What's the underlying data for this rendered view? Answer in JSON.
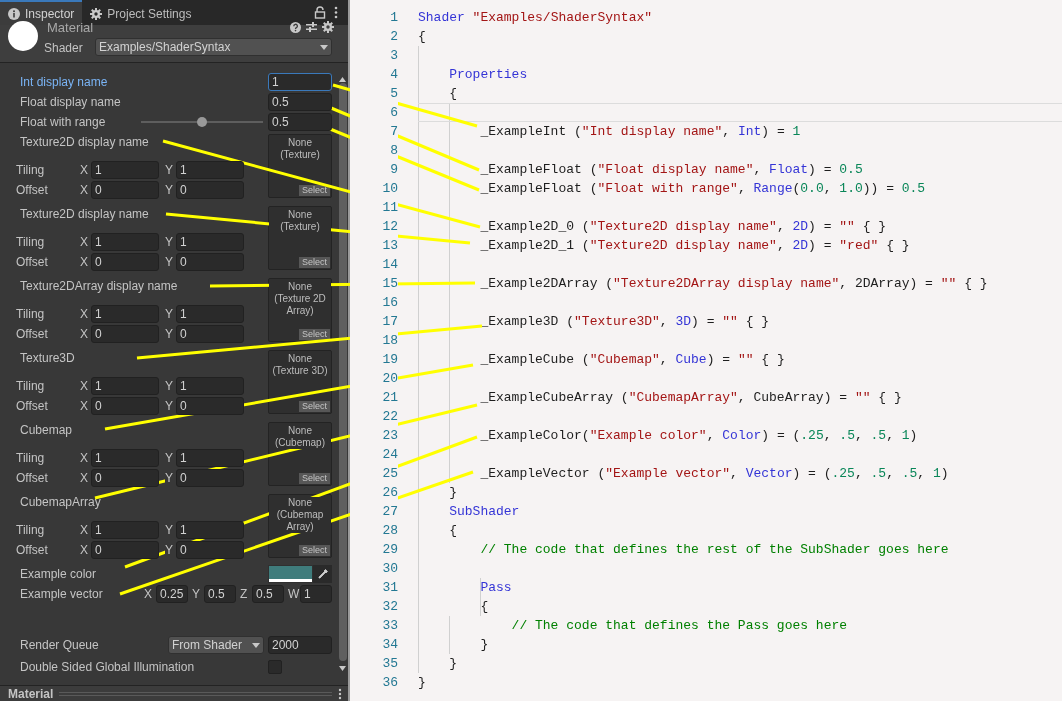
{
  "tabs": [
    {
      "label": "Inspector",
      "selected": true
    },
    {
      "label": "Project Settings",
      "selected": false
    }
  ],
  "header": {
    "title": "Material",
    "shader_label": "Shader",
    "shader_value": "Examples/ShaderSyntax"
  },
  "properties": [
    {
      "kind": "int",
      "label": "Int display name",
      "value": "1",
      "focused": true
    },
    {
      "kind": "float",
      "label": "Float display name",
      "value": "0.5",
      "focused": false
    },
    {
      "kind": "range",
      "label": "Float with range",
      "value": "0.5",
      "level": 0.5,
      "focused": false
    },
    {
      "kind": "texture",
      "label": "Texture2D display name",
      "focused": false,
      "thumbnail": "None (Texture)",
      "select": "Select",
      "tiling_label": "Tiling",
      "offset_label": "Offset",
      "tiling": [
        {
          "axis": "X",
          "value": "1"
        },
        {
          "axis": "Y",
          "value": "1"
        }
      ],
      "offset": [
        {
          "axis": "X",
          "value": "0"
        },
        {
          "axis": "Y",
          "value": "0"
        }
      ]
    },
    {
      "kind": "texture",
      "label": "Texture2D display name",
      "focused": false,
      "thumbnail": "None (Texture)",
      "select": "Select",
      "tiling_label": "Tiling",
      "offset_label": "Offset",
      "tiling": [
        {
          "axis": "X",
          "value": "1"
        },
        {
          "axis": "Y",
          "value": "1"
        }
      ],
      "offset": [
        {
          "axis": "X",
          "value": "0"
        },
        {
          "axis": "Y",
          "value": "0"
        }
      ]
    },
    {
      "kind": "texture",
      "label": "Texture2DArray display name",
      "focused": false,
      "thumbnail": "None (Texture 2D Array)",
      "select": "Select",
      "tiling_label": "Tiling",
      "offset_label": "Offset",
      "tiling": [
        {
          "axis": "X",
          "value": "1"
        },
        {
          "axis": "Y",
          "value": "1"
        }
      ],
      "offset": [
        {
          "axis": "X",
          "value": "0"
        },
        {
          "axis": "Y",
          "value": "0"
        }
      ]
    },
    {
      "kind": "texture",
      "label": "Texture3D",
      "focused": false,
      "thumbnail": "None (Texture 3D)",
      "select": "Select",
      "tiling_label": "Tiling",
      "offset_label": "Offset",
      "tiling": [
        {
          "axis": "X",
          "value": "1"
        },
        {
          "axis": "Y",
          "value": "1"
        }
      ],
      "offset": [
        {
          "axis": "X",
          "value": "0"
        },
        {
          "axis": "Y",
          "value": "0"
        }
      ]
    },
    {
      "kind": "texture",
      "label": "Cubemap",
      "focused": false,
      "thumbnail": "None (Cubemap)",
      "select": "Select",
      "tiling_label": "Tiling",
      "offset_label": "Offset",
      "tiling": [
        {
          "axis": "X",
          "value": "1"
        },
        {
          "axis": "Y",
          "value": "1"
        }
      ],
      "offset": [
        {
          "axis": "X",
          "value": "0"
        },
        {
          "axis": "Y",
          "value": "0"
        }
      ]
    },
    {
      "kind": "texture",
      "label": "CubemapArray",
      "focused": false,
      "thumbnail": "None (Cubemap Array)",
      "select": "Select",
      "tiling_label": "Tiling",
      "offset_label": "Offset",
      "tiling": [
        {
          "axis": "X",
          "value": "1"
        },
        {
          "axis": "Y",
          "value": "1"
        }
      ],
      "offset": [
        {
          "axis": "X",
          "value": "0"
        },
        {
          "axis": "Y",
          "value": "0"
        }
      ]
    },
    {
      "kind": "color",
      "label": "Example color",
      "focused": false,
      "color": "#3f7c7c"
    },
    {
      "kind": "vector",
      "label": "Example vector",
      "focused": false,
      "components": [
        {
          "axis": "X",
          "value": "0.25"
        },
        {
          "axis": "Y",
          "value": "0.5"
        },
        {
          "axis": "Z",
          "value": "0.5"
        },
        {
          "axis": "W",
          "value": "1"
        }
      ]
    }
  ],
  "render_queue": {
    "label": "Render Queue",
    "mode": "From Shader",
    "value": "2000"
  },
  "double_sided_gi": {
    "label": "Double Sided Global Illumination",
    "checked": false
  },
  "footer": {
    "title": "Material"
  },
  "code": {
    "lines": [
      {
        "number": "1",
        "current": false,
        "tokens": [
          {
            "kind": "keyword",
            "text": "Shader"
          },
          {
            "kind": "string",
            "text": " \"Examples/ShaderSyntax\""
          }
        ]
      },
      {
        "number": "2",
        "current": false,
        "tokens": [
          {
            "kind": "plain",
            "text": "{"
          }
        ]
      },
      {
        "number": "3",
        "current": false
      },
      {
        "number": "4",
        "current": false,
        "tokens": [
          {
            "kind": "keyword",
            "text": "    Properties"
          }
        ]
      },
      {
        "number": "5",
        "current": false,
        "tokens": [
          {
            "kind": "plain",
            "text": "    {"
          }
        ]
      },
      {
        "number": "6",
        "current": true
      },
      {
        "number": "7",
        "current": false,
        "tokens": [
          {
            "kind": "plain",
            "text": "        _ExampleInt ("
          },
          {
            "kind": "string",
            "text": "\"Int display name\""
          },
          {
            "kind": "plain",
            "text": ", "
          },
          {
            "kind": "keyword",
            "text": "Int"
          },
          {
            "kind": "plain",
            "text": ") = "
          },
          {
            "kind": "number",
            "text": "1"
          }
        ]
      },
      {
        "number": "8",
        "current": false
      },
      {
        "number": "9",
        "current": false,
        "tokens": [
          {
            "kind": "plain",
            "text": "        _ExampleFloat ("
          },
          {
            "kind": "string",
            "text": "\"Float display name\""
          },
          {
            "kind": "plain",
            "text": ", "
          },
          {
            "kind": "keyword",
            "text": "Float"
          },
          {
            "kind": "plain",
            "text": ") = "
          },
          {
            "kind": "number",
            "text": "0.5"
          }
        ]
      },
      {
        "number": "10",
        "current": false,
        "tokens": [
          {
            "kind": "plain",
            "text": "        _ExampleFloat ("
          },
          {
            "kind": "string",
            "text": "\"Float with range\""
          },
          {
            "kind": "plain",
            "text": ", "
          },
          {
            "kind": "keyword",
            "text": "Range"
          },
          {
            "kind": "plain",
            "text": "("
          },
          {
            "kind": "number",
            "text": "0.0"
          },
          {
            "kind": "plain",
            "text": ", "
          },
          {
            "kind": "number",
            "text": "1.0"
          },
          {
            "kind": "plain",
            "text": ")) = "
          },
          {
            "kind": "number",
            "text": "0.5"
          }
        ]
      },
      {
        "number": "11",
        "current": false
      },
      {
        "number": "12",
        "current": false,
        "tokens": [
          {
            "kind": "plain",
            "text": "        _Example2D_0 ("
          },
          {
            "kind": "string",
            "text": "\"Texture2D display name\""
          },
          {
            "kind": "plain",
            "text": ", "
          },
          {
            "kind": "keyword",
            "text": "2D"
          },
          {
            "kind": "plain",
            "text": ") = "
          },
          {
            "kind": "string",
            "text": "\"\""
          },
          {
            "kind": "plain",
            "text": " { }"
          }
        ]
      },
      {
        "number": "13",
        "current": false,
        "tokens": [
          {
            "kind": "plain",
            "text": "        _Example2D_1 ("
          },
          {
            "kind": "string",
            "text": "\"Texture2D display name\""
          },
          {
            "kind": "plain",
            "text": ", "
          },
          {
            "kind": "keyword",
            "text": "2D"
          },
          {
            "kind": "plain",
            "text": ") = "
          },
          {
            "kind": "string",
            "text": "\"red\""
          },
          {
            "kind": "plain",
            "text": " { }"
          }
        ]
      },
      {
        "number": "14",
        "current": false
      },
      {
        "number": "15",
        "current": false,
        "tokens": [
          {
            "kind": "plain",
            "text": "        _Example2DArray ("
          },
          {
            "kind": "string",
            "text": "\"Texture2DArray display name\""
          },
          {
            "kind": "plain",
            "text": ", 2DArray) = "
          },
          {
            "kind": "string",
            "text": "\"\""
          },
          {
            "kind": "plain",
            "text": " { }"
          }
        ]
      },
      {
        "number": "16",
        "current": false
      },
      {
        "number": "17",
        "current": false,
        "tokens": [
          {
            "kind": "plain",
            "text": "        _Example3D ("
          },
          {
            "kind": "string",
            "text": "\"Texture3D\""
          },
          {
            "kind": "plain",
            "text": ", "
          },
          {
            "kind": "keyword",
            "text": "3D"
          },
          {
            "kind": "plain",
            "text": ") = "
          },
          {
            "kind": "string",
            "text": "\"\""
          },
          {
            "kind": "plain",
            "text": " { }"
          }
        ]
      },
      {
        "number": "18",
        "current": false
      },
      {
        "number": "19",
        "current": false,
        "tokens": [
          {
            "kind": "plain",
            "text": "        _ExampleCube ("
          },
          {
            "kind": "string",
            "text": "\"Cubemap\""
          },
          {
            "kind": "plain",
            "text": ", "
          },
          {
            "kind": "keyword",
            "text": "Cube"
          },
          {
            "kind": "plain",
            "text": ") = "
          },
          {
            "kind": "string",
            "text": "\"\""
          },
          {
            "kind": "plain",
            "text": " { }"
          }
        ]
      },
      {
        "number": "20",
        "current": false
      },
      {
        "number": "21",
        "current": false,
        "tokens": [
          {
            "kind": "plain",
            "text": "        _ExampleCubeArray ("
          },
          {
            "kind": "string",
            "text": "\"CubemapArray\""
          },
          {
            "kind": "plain",
            "text": ", CubeArray) = "
          },
          {
            "kind": "string",
            "text": "\"\""
          },
          {
            "kind": "plain",
            "text": " { }"
          }
        ]
      },
      {
        "number": "22",
        "current": false
      },
      {
        "number": "23",
        "current": false,
        "tokens": [
          {
            "kind": "plain",
            "text": "        _ExampleColor("
          },
          {
            "kind": "string",
            "text": "\"Example color\""
          },
          {
            "kind": "plain",
            "text": ", "
          },
          {
            "kind": "keyword",
            "text": "Color"
          },
          {
            "kind": "plain",
            "text": ") = ("
          },
          {
            "kind": "number",
            "text": ".25"
          },
          {
            "kind": "plain",
            "text": ", "
          },
          {
            "kind": "number",
            "text": ".5"
          },
          {
            "kind": "plain",
            "text": ", "
          },
          {
            "kind": "number",
            "text": ".5"
          },
          {
            "kind": "plain",
            "text": ", "
          },
          {
            "kind": "number",
            "text": "1"
          },
          {
            "kind": "plain",
            "text": ")"
          }
        ]
      },
      {
        "number": "24",
        "current": false
      },
      {
        "number": "25",
        "current": false,
        "tokens": [
          {
            "kind": "plain",
            "text": "        _ExampleVector ("
          },
          {
            "kind": "string",
            "text": "\"Example vector\""
          },
          {
            "kind": "plain",
            "text": ", "
          },
          {
            "kind": "keyword",
            "text": "Vector"
          },
          {
            "kind": "plain",
            "text": ") = ("
          },
          {
            "kind": "number",
            "text": ".25"
          },
          {
            "kind": "plain",
            "text": ", "
          },
          {
            "kind": "number",
            "text": ".5"
          },
          {
            "kind": "plain",
            "text": ", "
          },
          {
            "kind": "number",
            "text": ".5"
          },
          {
            "kind": "plain",
            "text": ", "
          },
          {
            "kind": "number",
            "text": "1"
          },
          {
            "kind": "plain",
            "text": ")"
          }
        ]
      },
      {
        "number": "26",
        "current": false,
        "tokens": [
          {
            "kind": "plain",
            "text": "    }"
          }
        ]
      },
      {
        "number": "27",
        "current": false,
        "tokens": [
          {
            "kind": "keyword",
            "text": "    SubShader"
          }
        ]
      },
      {
        "number": "28",
        "current": false,
        "tokens": [
          {
            "kind": "plain",
            "text": "    {"
          }
        ]
      },
      {
        "number": "29",
        "current": false,
        "tokens": [
          {
            "kind": "comment",
            "text": "        // The code that defines the rest of the SubShader goes here"
          }
        ]
      },
      {
        "number": "30",
        "current": false
      },
      {
        "number": "31",
        "current": false,
        "tokens": [
          {
            "kind": "keyword",
            "text": "        Pass"
          }
        ]
      },
      {
        "number": "32",
        "current": false,
        "tokens": [
          {
            "kind": "plain",
            "text": "        {"
          }
        ]
      },
      {
        "number": "33",
        "current": false,
        "tokens": [
          {
            "kind": "comment",
            "text": "            // The code that defines the Pass goes here"
          }
        ]
      },
      {
        "number": "34",
        "current": false,
        "tokens": [
          {
            "kind": "plain",
            "text": "        }"
          }
        ]
      },
      {
        "number": "35",
        "current": false,
        "tokens": [
          {
            "kind": "plain",
            "text": "    }"
          }
        ]
      },
      {
        "number": "36",
        "current": false,
        "tokens": [
          {
            "kind": "plain",
            "text": "}"
          }
        ]
      }
    ]
  }
}
